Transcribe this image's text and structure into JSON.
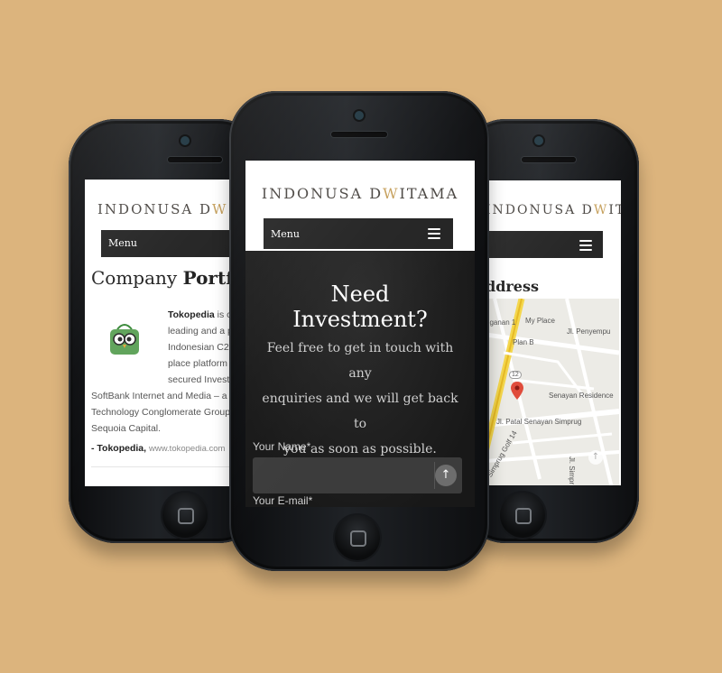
{
  "brand": {
    "logo_main": "INDONUSA D",
    "logo_w": "W",
    "logo_end": "ITAMA"
  },
  "nav": {
    "menu_label": "Menu"
  },
  "left_screen": {
    "heading_regular": "Company ",
    "heading_bold": "Portfo",
    "company_name": "Tokopedia",
    "lines": [
      " is c",
      "leading and a p",
      "Indonesian C2",
      "place platform",
      "secured Invest",
      "SoftBank Internet and Media – a",
      "Technology Conglomerate Group",
      "Sequoia Capital."
    ],
    "sig_name": "- Tokopedia,",
    "sig_url": "www.tokopedia.com"
  },
  "middle_screen": {
    "title_line1": "Need",
    "title_line2": "Investment?",
    "subtitle_lines": [
      "Feel free to get in touch with any",
      "enquiries and we will get back to",
      "you as soon as possible."
    ],
    "field_name_label": "Your Name*",
    "field_email_label": "Your E-mail*"
  },
  "right_screen": {
    "heading": "ddress",
    "map_labels": {
      "street1": "gganan 1",
      "place1": "My Place",
      "street2": "Jl. Penyempu",
      "place2": "Plan B",
      "place3": "Senayan Residence",
      "street3": "Jl. Patal Senayan Simprug",
      "street4": "Simprug Golf 14",
      "street5": "Jl. Simpr",
      "route": "12"
    }
  },
  "colors": {
    "background": "#dcb47d",
    "navbar": "#242424",
    "hero": "#1d1d1d",
    "logo_accent": "#c6a05c"
  }
}
